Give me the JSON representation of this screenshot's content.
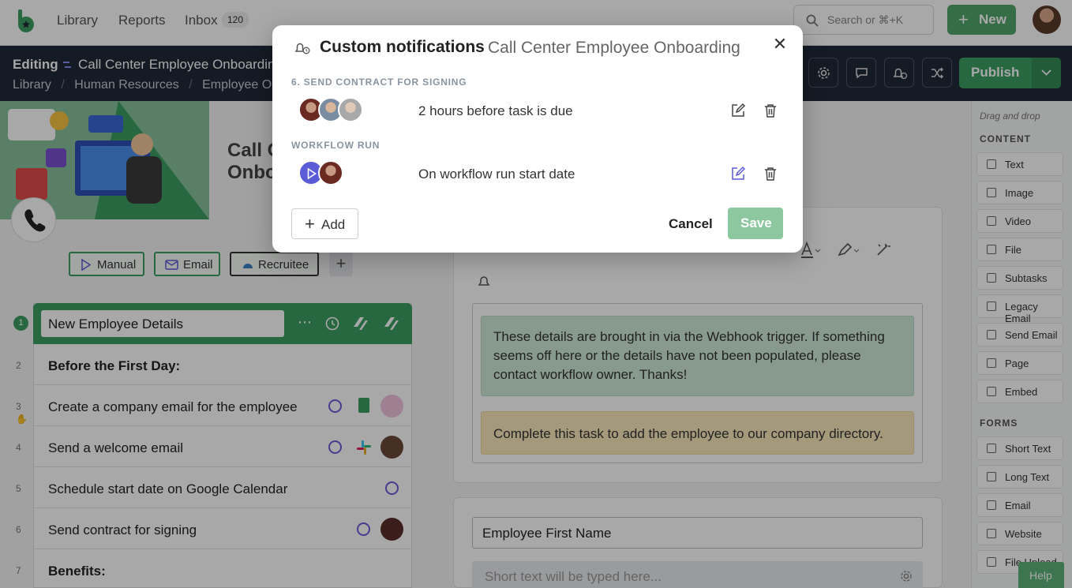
{
  "colors": {
    "brand_green": "#3e9e63",
    "dark_bar": "#1f2937",
    "accent_purple": "#5b5bd6"
  },
  "topnav": {
    "links": [
      "Library",
      "Reports",
      "Inbox"
    ],
    "inbox_count": "120",
    "search_placeholder": "Search or ⌘+K",
    "new_label": "New"
  },
  "editbar": {
    "editing_label": "Editing",
    "title": "Call Center Employee Onboardin",
    "breadcrumb": [
      "Library",
      "/",
      "Human Resources",
      "/",
      "Employee O"
    ],
    "publish_label": "Publish"
  },
  "left": {
    "doc_title_line1": "Call C",
    "doc_title_line2": "Onbo",
    "tags": [
      "Manual",
      "Email",
      "Recruitee"
    ],
    "tasks": [
      {
        "num": "1",
        "text": "New Employee Details"
      },
      {
        "num": "2",
        "text": "Before the First Day:",
        "bold": true
      },
      {
        "num": "3",
        "text": "Create a company email for the employee"
      },
      {
        "num": "4",
        "text": "Send a welcome email"
      },
      {
        "num": "5",
        "text": "Schedule start date on Google Calendar"
      },
      {
        "num": "6",
        "text": "Send contract for signing"
      },
      {
        "num": "7",
        "text": "Benefits:",
        "bold": true
      }
    ]
  },
  "editor": {
    "green_note": "These details are brought in via the Webhook trigger. If something seems off here or the details have not been populated, please contact workflow owner. Thanks!",
    "yellow_note": "Complete this task to add the employee to our company directory.",
    "field_label": "Employee First Name",
    "field_placeholder": "Short text will be typed here..."
  },
  "sidebar": {
    "hint": "Drag and drop",
    "content_title": "CONTENT",
    "content_items": [
      "Text",
      "Image",
      "Video",
      "File",
      "Subtasks",
      "Legacy Email",
      "Send Email",
      "Page",
      "Embed"
    ],
    "forms_title": "FORMS",
    "form_items": [
      "Short Text",
      "Long Text",
      "Email",
      "Website",
      "File Upload"
    ],
    "help_label": "Help"
  },
  "modal": {
    "title": "Custom notifications",
    "subtitle": "Call Center Employee Onboarding",
    "sections": [
      {
        "label": "6. SEND CONTRACT FOR SIGNING",
        "text": "2 hours before task is due"
      },
      {
        "label": "WORKFLOW RUN",
        "text": "On workflow run start date"
      }
    ],
    "add_label": "Add",
    "cancel_label": "Cancel",
    "save_label": "Save"
  }
}
